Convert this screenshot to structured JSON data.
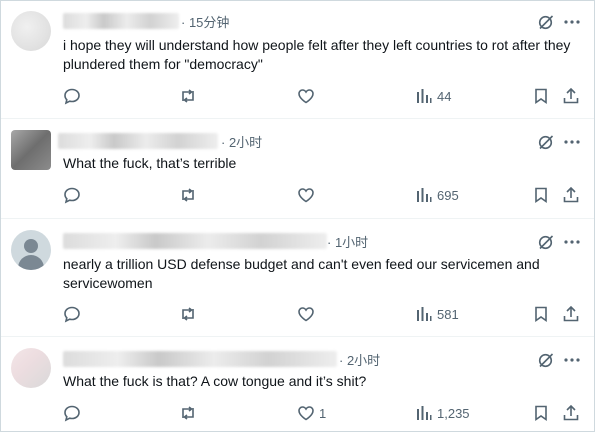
{
  "replies": [
    {
      "time": "· 15分钟",
      "text": "i hope they will understand how people felt after they left countries to rot after they plundered them for \"democracy\"",
      "likes": "",
      "views": "44"
    },
    {
      "time": "· 2小时",
      "text": "What the fuck, that’s terrible",
      "likes": "",
      "views": "695"
    },
    {
      "time": "· 1小时",
      "text": "nearly a trillion USD defense budget and can't even feed our servicemen and servicewomen",
      "likes": "",
      "views": "581"
    },
    {
      "time": "· 2小时",
      "text": "What the fuck is that? A cow tongue and it’s shit?",
      "likes": "1",
      "views": "1,235"
    }
  ],
  "icons": {
    "grok": "grok-icon",
    "more": "more-icon",
    "reply": "reply-icon",
    "repost": "repost-icon",
    "like": "like-icon",
    "views": "views-icon",
    "bookmark": "bookmark-icon",
    "share": "share-icon"
  },
  "colors": {
    "text": "#0f1419",
    "secondary": "#536471",
    "divider": "#eff3f4"
  }
}
